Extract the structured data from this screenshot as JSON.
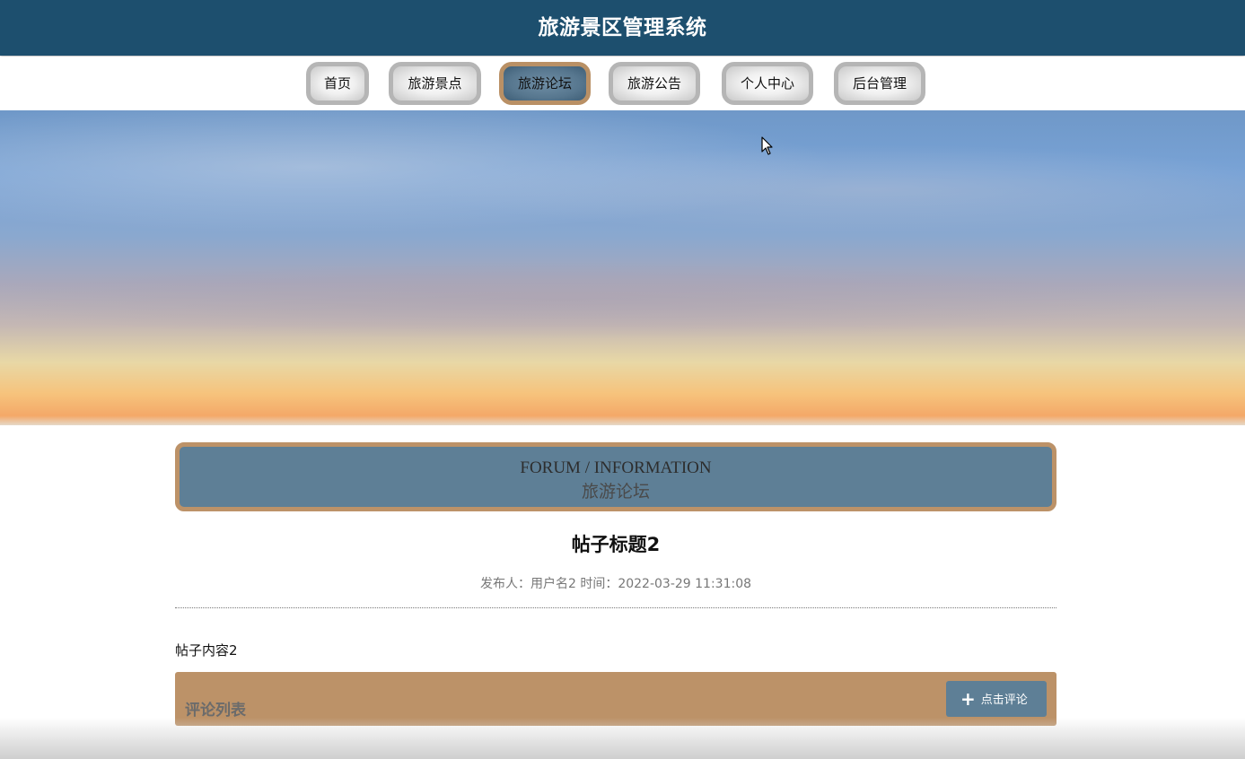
{
  "header": {
    "title": "旅游景区管理系统"
  },
  "nav": {
    "items": [
      {
        "label": "首页"
      },
      {
        "label": "旅游景点"
      },
      {
        "label": "旅游论坛",
        "active": true
      },
      {
        "label": "旅游公告"
      },
      {
        "label": "个人中心"
      },
      {
        "label": "后台管理"
      }
    ]
  },
  "section": {
    "title_en": "FORUM / INFORMATION",
    "title_cn": "旅游论坛"
  },
  "post": {
    "title": "帖子标题2",
    "meta": "发布人：用户名2 时间：2022-03-29 11:31:08",
    "content": "帖子内容2"
  },
  "comments": {
    "label": "评论列表",
    "button_label": "点击评论",
    "button_icon": "plus-icon"
  },
  "colors": {
    "header_bg": "#1d4f6e",
    "accent_brown": "#bc9268",
    "panel_blue": "#5e7f96"
  }
}
